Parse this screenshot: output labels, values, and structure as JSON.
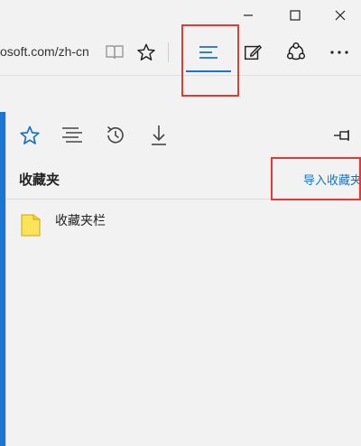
{
  "window": {
    "minimize_icon": "minimize-icon",
    "maximize_icon": "maximize-icon",
    "close_icon": "close-icon"
  },
  "toolbar": {
    "address_text": "osoft.com/zh-cn",
    "icons": [
      "reading-view-icon",
      "star-icon",
      "hub-icon",
      "web-note-icon",
      "share-icon",
      "more-icon"
    ],
    "active": "hub-icon",
    "accent_color": "#1a73c8",
    "highlight_color": "#e53935"
  },
  "hub": {
    "tabs": [
      "favorites-star-icon",
      "reading-list-icon",
      "history-icon",
      "downloads-icon"
    ],
    "active_tab": "favorites-star-icon",
    "pin_icon": "pin-icon",
    "title": "收藏夹",
    "import_link": "导入收藏夹",
    "items": [
      {
        "label": "收藏夹栏",
        "icon": "folder-icon"
      }
    ]
  }
}
